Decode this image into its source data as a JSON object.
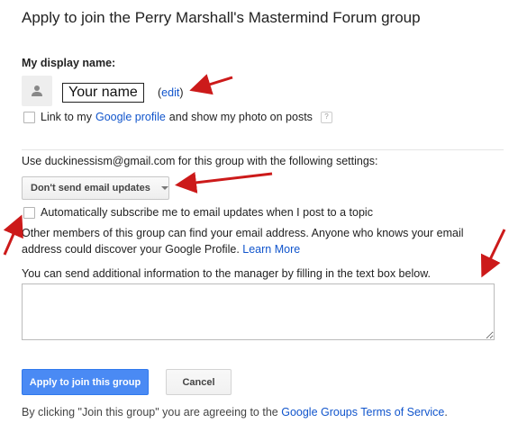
{
  "page": {
    "title": "Apply to join the Perry Marshall's Mastermind Forum group"
  },
  "display_name": {
    "section_label": "My display name:",
    "name_value": "Your name",
    "edit_open": "(",
    "edit_link": "edit",
    "edit_close": ")",
    "link_profile_prefix": "Link to my",
    "link_profile_link": "Google profile",
    "link_profile_suffix": "and show my photo on posts",
    "link_profile_checked": false,
    "help_icon_text": "?"
  },
  "settings": {
    "use_email_text": "Use duckinessism@gmail.com for this group with the following settings:",
    "dropdown_selected": "Don't send email updates",
    "auto_subscribe_label": "Automatically subscribe me to email updates when I post to a topic",
    "auto_subscribe_checked": false,
    "info_text": "Other members of this group can find your email address. Anyone who knows your email address could discover your Google Profile.",
    "learn_more_link": "Learn More"
  },
  "additional_info": {
    "label": "You can send additional information to the manager by filling in the text box below.",
    "value": ""
  },
  "actions": {
    "apply_label": "Apply to join this group",
    "cancel_label": "Cancel"
  },
  "footer": {
    "prefix": "By clicking \"Join this group\" you are agreeing to the",
    "tos_link": "Google Groups Terms of Service",
    "suffix": "."
  },
  "annotation_color": "#cc1a1a",
  "accent_color": "#4a8af4",
  "link_color": "#1155cc"
}
